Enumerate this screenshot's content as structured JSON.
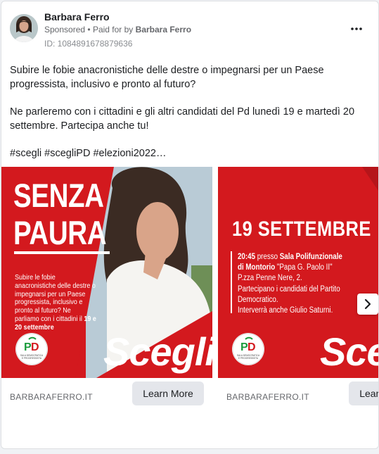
{
  "post": {
    "page_name": "Barbara Ferro",
    "sponsored_label": "Sponsored",
    "paid_for_prefix": "Paid for by",
    "paid_for_by": "Barbara Ferro",
    "separator": "•",
    "ad_id": "ID: 1084891678879636",
    "more_label": "•••",
    "body_paragraphs": [
      "Subire le fobie anacronistiche delle destre o impegnarsi per un Paese progressista, inclusivo e pronto al futuro?",
      "Ne parleremo con i cittadini e gli altri candidati del Pd lunedì 19 e martedì 20 settembre. Partecipa anche tu!",
      "#scegli #scegliPD #elezioni2022…"
    ]
  },
  "carousel": {
    "cards": [
      {
        "domain": "BARBARAFERRO.IT",
        "cta": "Learn More",
        "headline_line1": "SENZA",
        "headline_line2": "PAURA",
        "text_part1": "Subire le fobie anacronistiche delle destre o impegnarsi per un Paese progressista, inclusivo e pronto al futuro? Ne parliamo con i cittadini il ",
        "text_bold": "19 e 20 settembre",
        "slogan": "Scegli."
      },
      {
        "domain": "BARBARAFERRO.IT",
        "cta": "Learn More",
        "date_headline": "19 SETTEMBRE",
        "line1_time": "20:45",
        "line1_mid": " presso ",
        "line1_place": "Sala Polifunzionale",
        "line2_place": "di Montorio",
        "line2_rest": " \"Papa G. Paolo II\"",
        "line3": "P.zza Penne Nere, 2.",
        "line4": "Partecipano i candidati del Partito",
        "line5": "Democratico.",
        "line6": "Interverrà anche Giulio Saturni.",
        "slogan": "Sceg"
      }
    ],
    "next_arrow": "chevron-right"
  },
  "logo": {
    "text": "PD",
    "caption_line1": "SALA DEMOCRATICA",
    "caption_line2": "E PROGRESSISTA"
  },
  "colors": {
    "brand_red": "#d3191e",
    "pd_green": "#1a9b3c",
    "cta_bg": "#e4e6eb",
    "meta_text": "#65676b"
  }
}
